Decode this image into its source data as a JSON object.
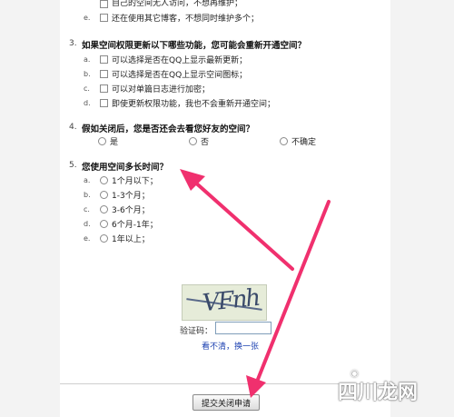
{
  "q2": {
    "option_d_partial": "自己的空间无人访问，不想再维护；",
    "option_e": "还在使用其它博客，不想同时维护多个；"
  },
  "q3": {
    "number": "3.",
    "title": "如果空间权限更新以下哪些功能，您可能会重新开通空间？",
    "options": [
      {
        "letter": "a.",
        "label": "可以选择是否在QQ上显示最新更新；"
      },
      {
        "letter": "b.",
        "label": "可以选择是否在QQ上显示空间图标；"
      },
      {
        "letter": "c.",
        "label": "可以对单篇日志进行加密；"
      },
      {
        "letter": "d.",
        "label": "即使更新权限功能，我也不会重新开通空间；"
      }
    ]
  },
  "q4": {
    "number": "4.",
    "title": "假如关闭后，您是否还会去看您好友的空间？",
    "options": [
      "是",
      "否",
      "不确定"
    ]
  },
  "q5": {
    "number": "5.",
    "title": "您使用空间多长时间？",
    "options": [
      {
        "letter": "a.",
        "label": "1个月以下；"
      },
      {
        "letter": "b.",
        "label": "1-3个月；"
      },
      {
        "letter": "c.",
        "label": "3-6个月；"
      },
      {
        "letter": "d.",
        "label": "6个月-1年；"
      },
      {
        "letter": "e.",
        "label": "1年以上；"
      }
    ]
  },
  "captcha": {
    "image_text": "VFnh",
    "code_label": "验证码：",
    "code_value": "",
    "refresh_link": "看不清，换一张"
  },
  "submit_button": "提交关闭申请",
  "watermark": {
    "text": "四川龙网"
  },
  "colors": {
    "arrow": "#f0306e",
    "link": "#1a3fb0"
  }
}
